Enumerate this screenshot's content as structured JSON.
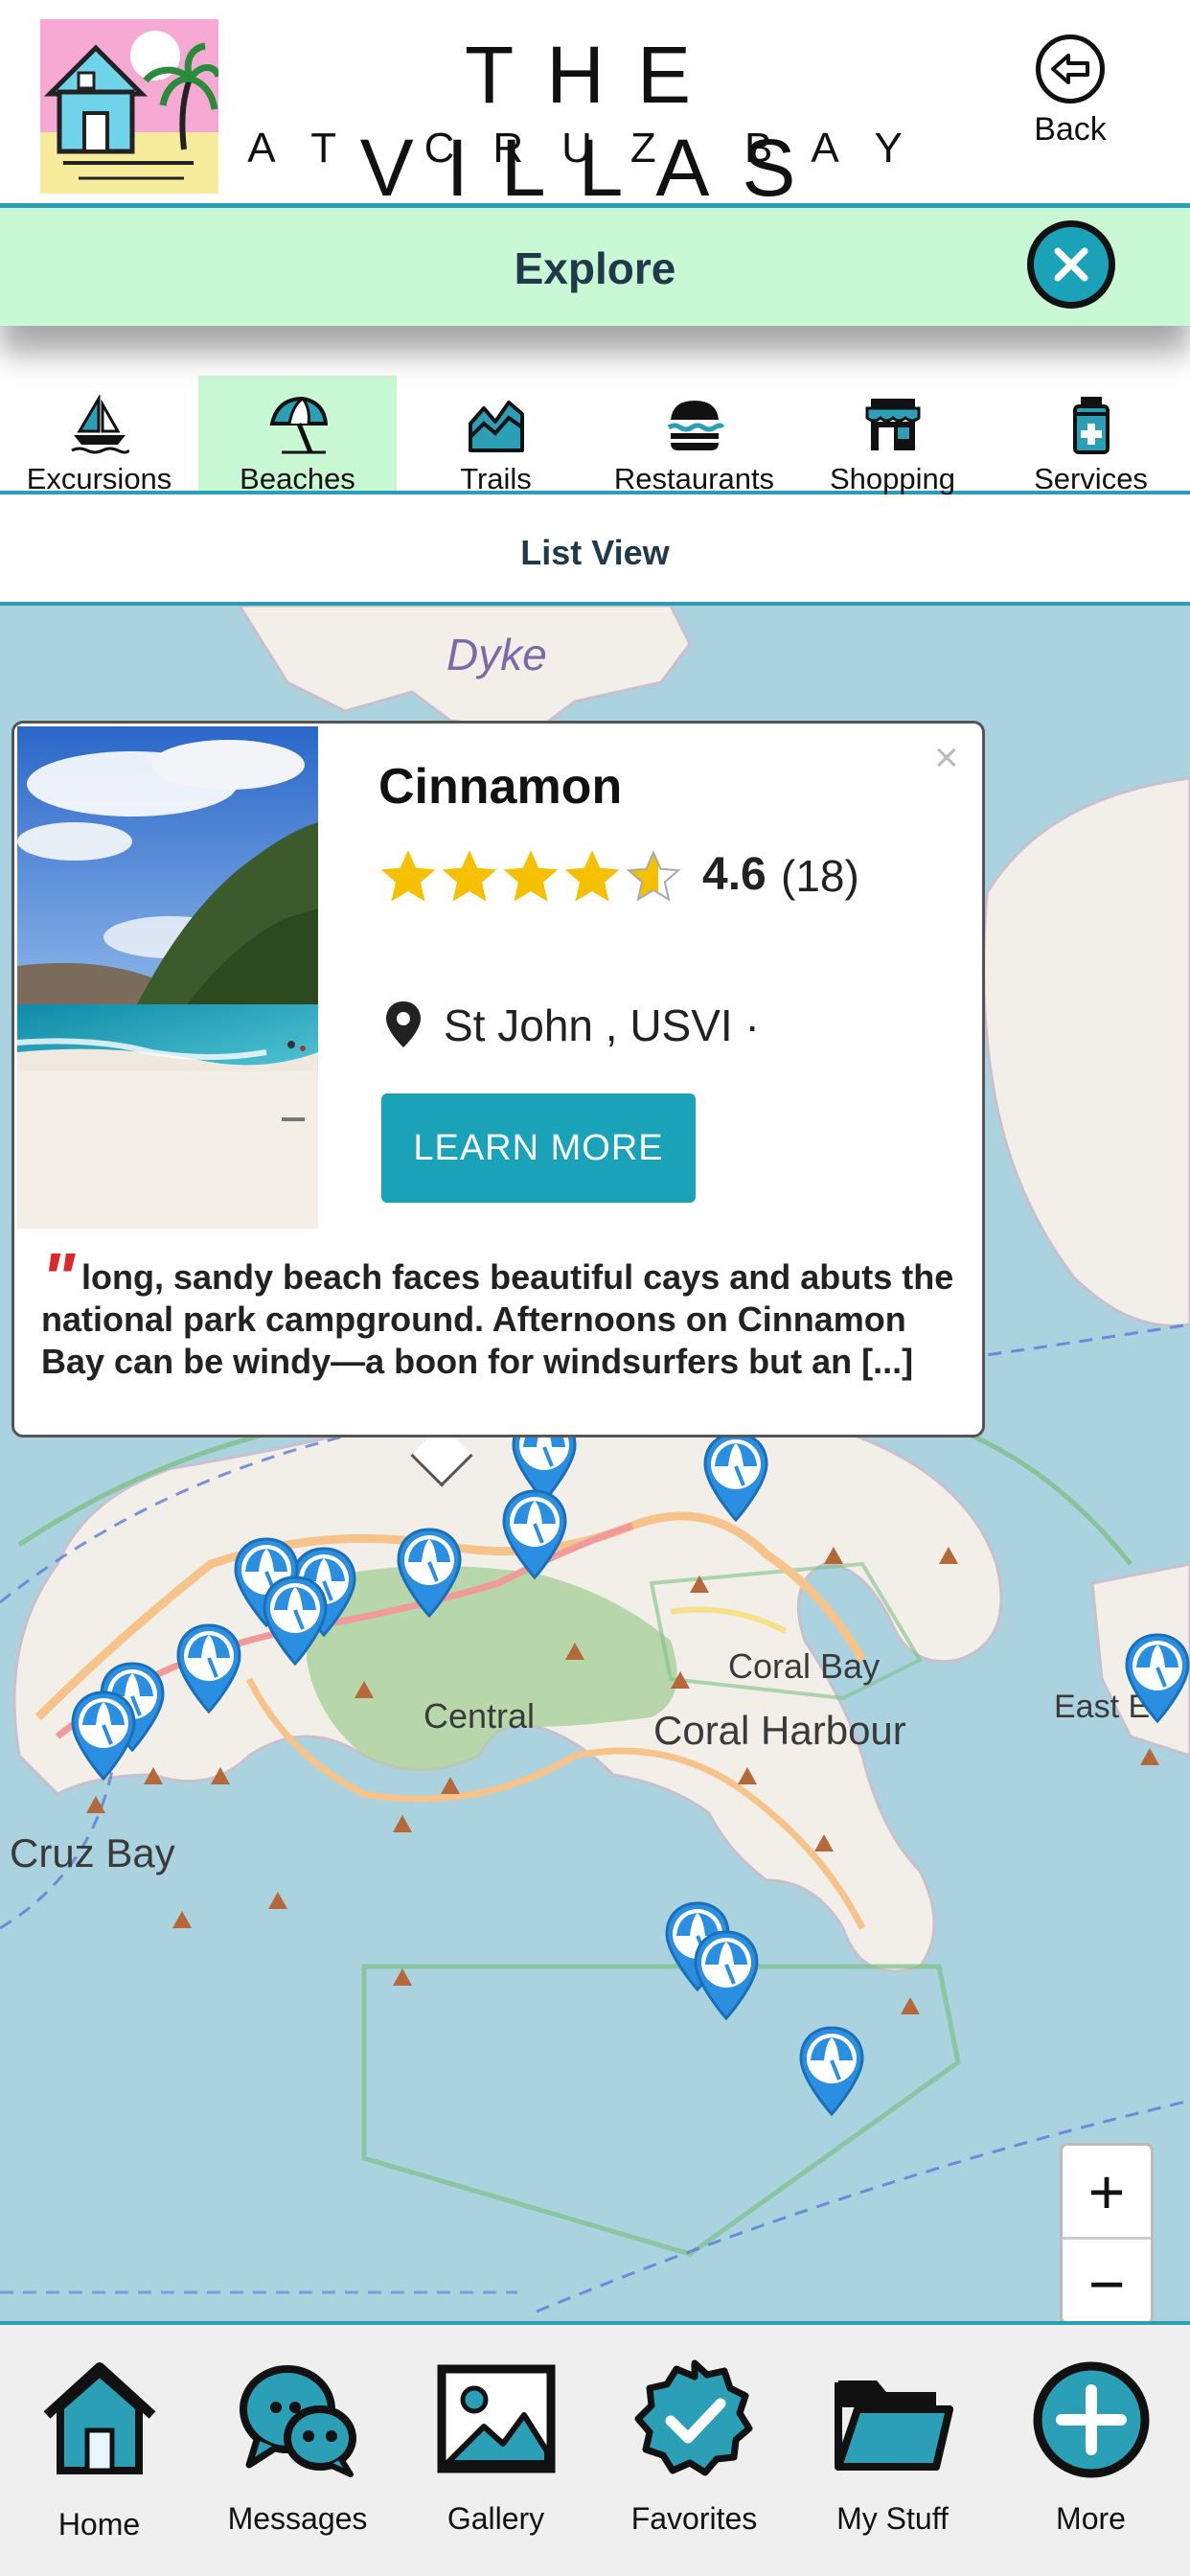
{
  "header": {
    "brand_line1": "THE VILLAS",
    "brand_line2": "AT CRUZ BAY",
    "back_label": "Back"
  },
  "explore": {
    "title": "Explore",
    "close_icon": "close-icon"
  },
  "categories": [
    {
      "label": "Excursions",
      "icon": "sailboat-icon",
      "active": false
    },
    {
      "label": "Beaches",
      "icon": "beach-umbrella-icon",
      "active": true
    },
    {
      "label": "Trails",
      "icon": "mountain-trail-icon",
      "active": false
    },
    {
      "label": "Restaurants",
      "icon": "burger-icon",
      "active": false
    },
    {
      "label": "Shopping",
      "icon": "store-icon",
      "active": false
    },
    {
      "label": "Services",
      "icon": "first-aid-bottle-icon",
      "active": false
    }
  ],
  "list_view": {
    "label": "List View"
  },
  "map": {
    "labels": [
      "Dyke",
      "Coral Bay",
      "Coral Harbour",
      "Central",
      "Cruz Bay",
      "East E"
    ],
    "zoom_in": "+",
    "zoom_out": "−"
  },
  "popup": {
    "title": "Cinnamon",
    "rating": "4.6",
    "rating_count": "(18)",
    "rating_value": 4.6,
    "location": "St John , USVI ·",
    "cta": "LEARN MORE",
    "quote_mark": "\"",
    "description": "long, sandy beach faces beautiful cays and abuts the national park campground. Afternoons on Cinnamon Bay can be windy—a boon for windsurfers but an [...]",
    "close": "×"
  },
  "bottom_nav": [
    {
      "label": "Home",
      "icon": "home-icon"
    },
    {
      "label": "Messages",
      "icon": "chat-bubbles-icon"
    },
    {
      "label": "Gallery",
      "icon": "image-icon"
    },
    {
      "label": "Favorites",
      "icon": "badge-check-icon"
    },
    {
      "label": "My Stuff",
      "icon": "folder-icon"
    },
    {
      "label": "More",
      "icon": "plus-circle-icon"
    }
  ],
  "colors": {
    "accent": "#1aa3b8",
    "highlight": "#c8f8d4",
    "divider": "#2a9fb5",
    "star": "#f5c000",
    "quote": "#e0262d",
    "water": "#aad3df",
    "land": "#f2efe9",
    "park": "#add19e"
  }
}
